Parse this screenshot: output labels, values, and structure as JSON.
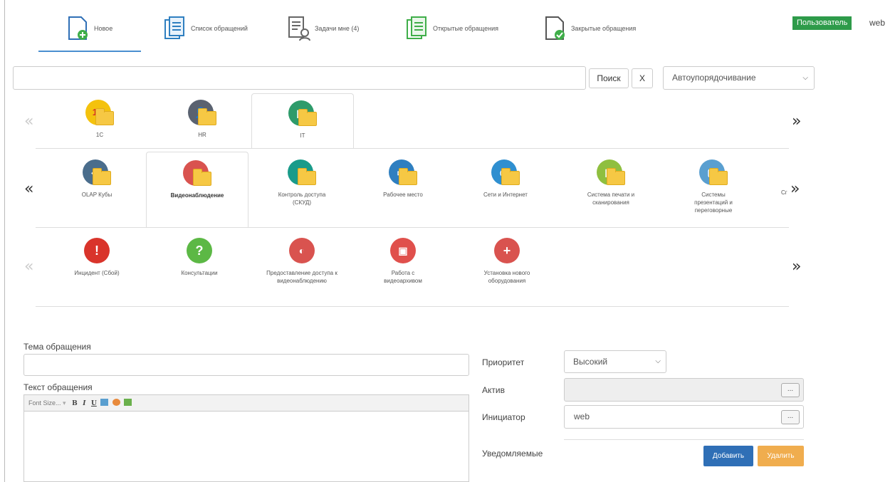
{
  "nav": {
    "tabs": [
      {
        "label": "Новое",
        "icon": "new-document-icon"
      },
      {
        "label": "Список обращений",
        "icon": "list-icon"
      },
      {
        "label": "Задачи мне (4)",
        "icon": "tasks-icon"
      },
      {
        "label": "Открытые обращения",
        "icon": "open-requests-icon"
      },
      {
        "label": "Закрытые обращения",
        "icon": "closed-requests-icon"
      }
    ],
    "user_badge": "Пользователь",
    "user_name": "web"
  },
  "search": {
    "placeholder": "",
    "search_label": "Поиск",
    "clear_label": "X",
    "sort_value": "Автоупорядочивание"
  },
  "rows": {
    "arrow_left": "«",
    "arrow_right": "»",
    "row1": [
      {
        "label": "1C",
        "color": "#f4c20d",
        "glyph": "1С"
      },
      {
        "label": "HR",
        "color": "#5a6270",
        "glyph": "👤"
      },
      {
        "label": "IT",
        "color": "#2e9b6a",
        "glyph": "▦"
      }
    ],
    "row2": [
      {
        "label": "OLAP Кубы",
        "color": "#4a6d8c",
        "glyph": "◆"
      },
      {
        "label": "Видеонаблюдение",
        "color": "#d9534f",
        "glyph": "◐"
      },
      {
        "label": "Контроль доступа (СКУД)",
        "color": "#1a9b8a",
        "glyph": "▮"
      },
      {
        "label": "Рабочее место",
        "color": "#2f7fc0",
        "glyph": "▭"
      },
      {
        "label": "Сети и Интернет",
        "color": "#2f8fd0",
        "glyph": "◎"
      },
      {
        "label": "Система печати и сканирования",
        "color": "#8fbf3f",
        "glyph": "▤"
      },
      {
        "label": "Системы презентаций и переговорные",
        "color": "#5a9fd0",
        "glyph": "▢"
      }
    ],
    "row2_overflow": "Сг",
    "row3": [
      {
        "label": "Инцидент (Сбой)",
        "color": "#d9342b",
        "glyph": "!"
      },
      {
        "label": "Консультации",
        "color": "#5cb845",
        "glyph": "?"
      },
      {
        "label": "Предоставление доступа к видеонаблюдению",
        "color": "#d9534f",
        "glyph": "◐"
      },
      {
        "label": "Работа с видеоархивом",
        "color": "#e0504c",
        "glyph": "▣"
      },
      {
        "label": "Установка нового оборудования",
        "color": "#d9534f",
        "glyph": "+"
      }
    ]
  },
  "form": {
    "subject_label": "Тема обращения",
    "subject_value": "",
    "text_label": "Текст обращения",
    "font_size_placeholder": "Font Size...",
    "bold": "B",
    "italic": "I",
    "underline": "U",
    "priority_label": "Приоритет",
    "priority_value": "Высокий",
    "asset_label": "Актив",
    "asset_value": "",
    "initiator_label": "Инициатор",
    "initiator_value": "web",
    "notified_label": "Уведомляемые",
    "dots_label": "...",
    "add_label": "Добавить",
    "delete_label": "Удалить"
  }
}
